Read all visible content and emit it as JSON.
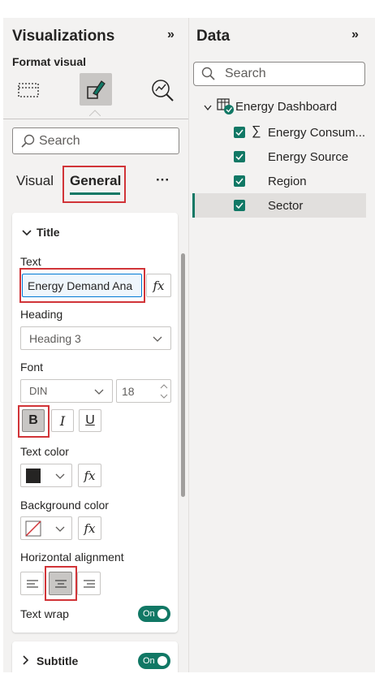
{
  "viz": {
    "title": "Visualizations",
    "format_visual_label": "Format visual",
    "search_placeholder": "Search",
    "tabs": {
      "visual": "Visual",
      "general": "General",
      "more": "···"
    },
    "title_section": {
      "header": "Title",
      "text_label": "Text",
      "text_value": "Energy Demand Ana",
      "heading_label": "Heading",
      "heading_value": "Heading 3",
      "font_label": "Font",
      "font_family_value": "DIN",
      "font_size_value": "18",
      "bold": "B",
      "italic": "I",
      "underline": "U",
      "text_color_label": "Text color",
      "bg_color_label": "Background color",
      "halign_label": "Horizontal alignment",
      "text_wrap_label": "Text wrap",
      "text_wrap_toggle": "On",
      "fx": "fx"
    },
    "subtitle_section": {
      "header": "Subtitle",
      "toggle": "On"
    }
  },
  "data": {
    "title": "Data",
    "search_placeholder": "Search",
    "table_name": "Energy Dashboard",
    "fields": [
      {
        "label": "Energy Consum...",
        "sigma": "∑"
      },
      {
        "label": "Energy Source",
        "sigma": ""
      },
      {
        "label": "Region",
        "sigma": ""
      },
      {
        "label": "Sector",
        "sigma": ""
      }
    ]
  },
  "colors": {
    "accent": "#117865",
    "highlight_red": "#d13438",
    "pane_bg": "#f3f2f1"
  }
}
